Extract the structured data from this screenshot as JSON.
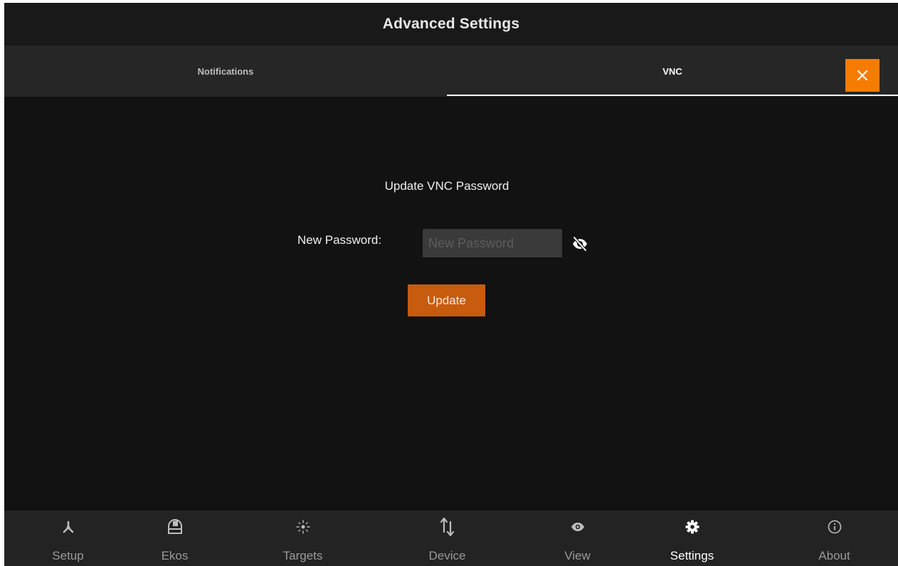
{
  "header": {
    "title": "Advanced Settings"
  },
  "tabs": [
    {
      "label": "Notifications",
      "selected": false
    },
    {
      "label": "VNC",
      "selected": true
    }
  ],
  "close_button": {
    "icon": "close-icon",
    "color": "#f57c00"
  },
  "vnc": {
    "section_title": "Update VNC Password",
    "password_label": "New Password:",
    "password_value": "",
    "password_placeholder": "New Password",
    "visibility_icon": "eye-off-icon",
    "update_label": "Update",
    "update_color": "#c75b0e"
  },
  "bottom_nav": {
    "items": [
      {
        "label": "Setup",
        "icon": "setup-icon",
        "active": false
      },
      {
        "label": "Ekos",
        "icon": "ekos-icon",
        "active": false
      },
      {
        "label": "Targets",
        "icon": "targets-icon",
        "active": false
      },
      {
        "label": "Device",
        "icon": "device-icon",
        "active": false
      },
      {
        "label": "View",
        "icon": "eye-icon",
        "active": false
      },
      {
        "label": "Settings",
        "icon": "gear-icon",
        "active": true
      },
      {
        "label": "About",
        "icon": "info-icon",
        "active": false
      }
    ]
  }
}
